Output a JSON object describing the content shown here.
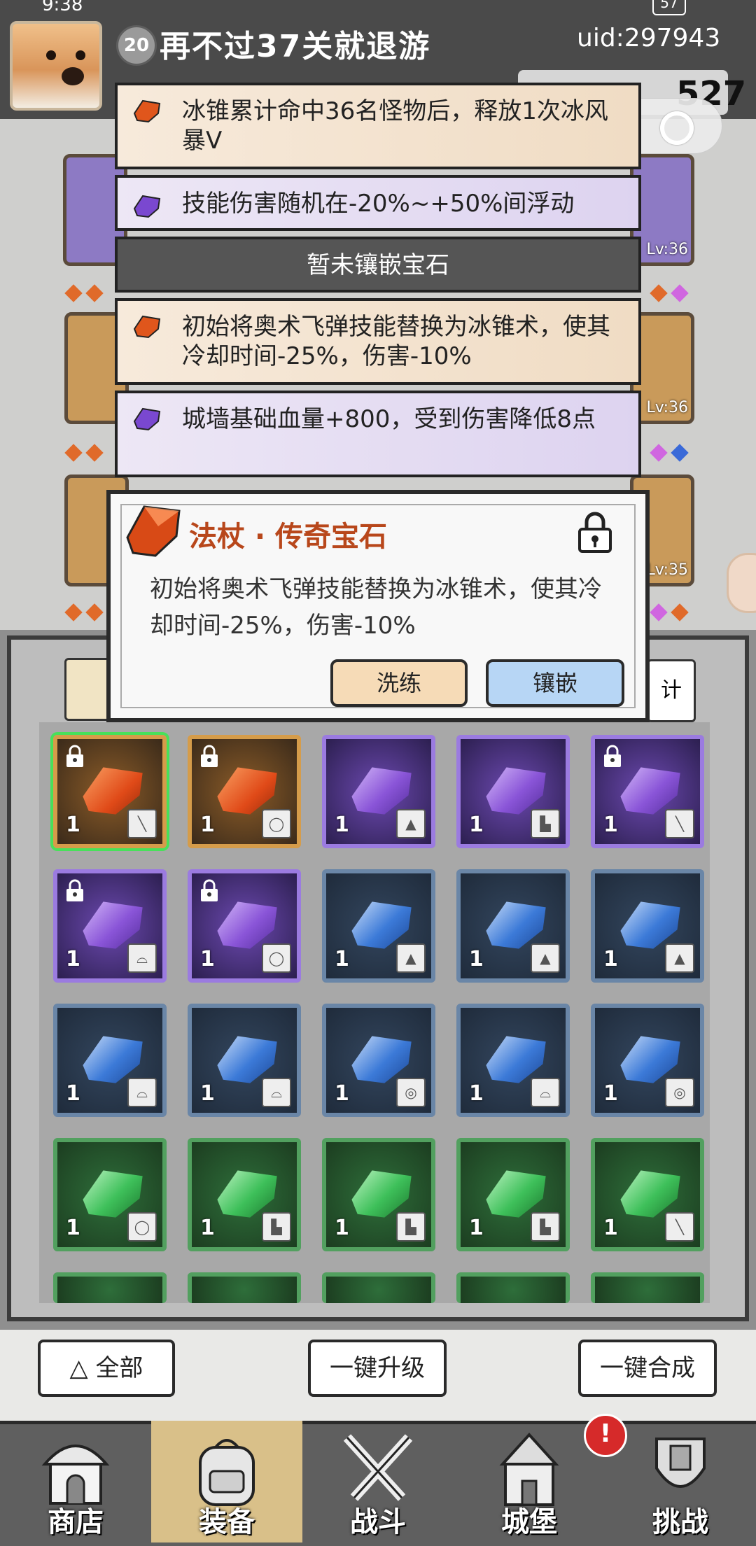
{
  "status": {
    "time": "9:38",
    "battery": "57"
  },
  "player": {
    "level": "20",
    "name": "再不过37关就退游",
    "uid": "uid:297943",
    "currency": "527"
  },
  "tooltips": [
    {
      "type": "orange",
      "text": "冰锥累计命中36名怪物后，释放1次冰风暴V"
    },
    {
      "type": "purple",
      "text": "技能伤害随机在-20%~+50%间浮动"
    },
    {
      "type": "dark",
      "text": "暂未镶嵌宝石"
    },
    {
      "type": "orange",
      "text": "初始将奥术飞弹技能替换为冰锥术，使其冷却时间-25%，伤害-10%"
    },
    {
      "type": "purple",
      "text": "城墙基础血量+800，受到伤害降低8点"
    }
  ],
  "equip_levels": [
    "Lv:36",
    "Lv:36",
    "Lv:35"
  ],
  "popup": {
    "title": "法杖 · 传奇宝石",
    "desc": "初始将奥术飞弹技能替换为冰锥术，使其冷却时间-25%，伤害-10%",
    "btn_refine": "洗练",
    "btn_inlay": "镶嵌"
  },
  "inventory": {
    "filter_right": "计",
    "items": [
      {
        "color": "orange",
        "qty": "1",
        "slot": "staff-icon",
        "locked": true,
        "selected": true
      },
      {
        "color": "orange",
        "qty": "1",
        "slot": "necklace-icon",
        "locked": true
      },
      {
        "color": "purple",
        "qty": "1",
        "slot": "armor-icon",
        "locked": false
      },
      {
        "color": "purple",
        "qty": "1",
        "slot": "boots-icon",
        "locked": false
      },
      {
        "color": "purple",
        "qty": "1",
        "slot": "staff-icon",
        "locked": true
      },
      {
        "color": "purple",
        "qty": "1",
        "slot": "hat-icon",
        "locked": true
      },
      {
        "color": "purple",
        "qty": "1",
        "slot": "necklace-icon",
        "locked": true
      },
      {
        "color": "blue",
        "qty": "1",
        "slot": "armor-icon",
        "locked": false
      },
      {
        "color": "blue",
        "qty": "1",
        "slot": "armor-icon",
        "locked": false
      },
      {
        "color": "blue",
        "qty": "1",
        "slot": "armor-icon",
        "locked": false
      },
      {
        "color": "blue",
        "qty": "1",
        "slot": "hat-icon",
        "locked": false
      },
      {
        "color": "blue",
        "qty": "1",
        "slot": "hat-icon",
        "locked": false
      },
      {
        "color": "blue",
        "qty": "1",
        "slot": "ring-icon",
        "locked": false
      },
      {
        "color": "blue",
        "qty": "1",
        "slot": "hat-icon",
        "locked": false
      },
      {
        "color": "blue",
        "qty": "1",
        "slot": "ring-icon",
        "locked": false
      },
      {
        "color": "green",
        "qty": "1",
        "slot": "necklace-icon",
        "locked": false
      },
      {
        "color": "green",
        "qty": "1",
        "slot": "boots-icon",
        "locked": false
      },
      {
        "color": "green",
        "qty": "1",
        "slot": "boots-icon",
        "locked": false
      },
      {
        "color": "green",
        "qty": "1",
        "slot": "boots-icon",
        "locked": false
      },
      {
        "color": "green",
        "qty": "1",
        "slot": "staff-icon",
        "locked": false
      }
    ]
  },
  "actions": {
    "all": "全部",
    "upgrade": "一键升级",
    "merge": "一键合成"
  },
  "nav": [
    {
      "label": "商店",
      "icon": "shop-icon",
      "active": false
    },
    {
      "label": "装备",
      "icon": "backpack-icon",
      "active": true
    },
    {
      "label": "战斗",
      "icon": "swords-icon",
      "active": false
    },
    {
      "label": "城堡",
      "icon": "castle-icon",
      "active": false
    },
    {
      "label": "挑战",
      "icon": "trophy-icon",
      "active": false
    }
  ],
  "notification": "!"
}
